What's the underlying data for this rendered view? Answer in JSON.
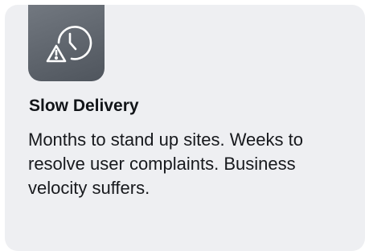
{
  "card": {
    "icon": "clock-warning-icon",
    "title": "Slow Delivery",
    "description": "Months to stand up sites. Weeks to resolve user complaints. Business velocity suffers."
  },
  "colors": {
    "card_background": "#eeeff2",
    "icon_tile": "#5f656d",
    "text": "#111418"
  }
}
